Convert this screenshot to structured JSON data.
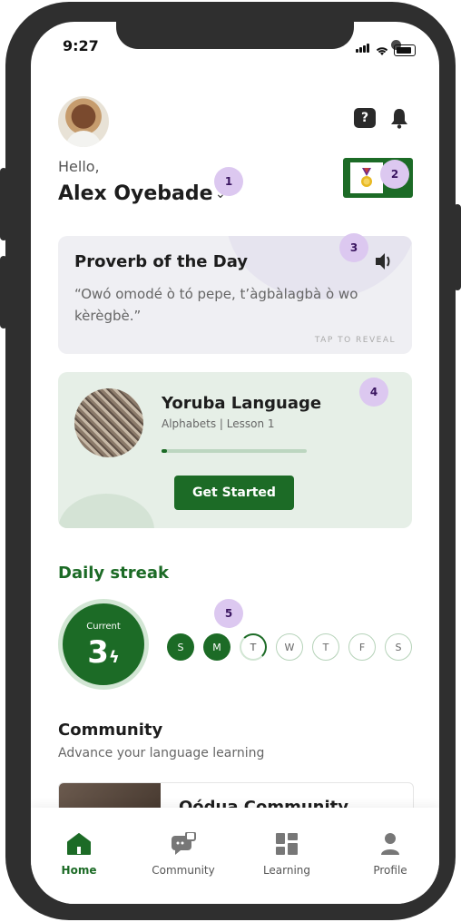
{
  "status_bar": {
    "time": "9:27"
  },
  "header": {
    "greeting": "Hello,",
    "user_name": "Alex Oyebade",
    "chevron": "⌄",
    "help_icon_text": "?"
  },
  "badges": [
    "1",
    "2",
    "3",
    "4",
    "5"
  ],
  "proverb": {
    "title": "Proverb of the Day",
    "text": "“Owó omodé ò tó pepe, t’àgbàlagbà ò wo kèrègbè.”",
    "reveal": "TAP TO REVEAL"
  },
  "lesson": {
    "title": "Yoruba Language",
    "subtitle": "Alphabets | Lesson 1",
    "progress": 0.04,
    "button": "Get Started"
  },
  "streak": {
    "title": "Daily streak",
    "current_label": "Current",
    "current_value": "3",
    "days": [
      {
        "label": "S",
        "state": "done"
      },
      {
        "label": "M",
        "state": "done"
      },
      {
        "label": "T",
        "state": "today"
      },
      {
        "label": "W",
        "state": "todo"
      },
      {
        "label": "T",
        "state": "todo"
      },
      {
        "label": "F",
        "state": "todo"
      },
      {
        "label": "S",
        "state": "todo"
      }
    ]
  },
  "community": {
    "title": "Community",
    "subtitle": "Advance your language learning",
    "card_name": "Oódua Community"
  },
  "tabs": [
    {
      "label": "Home",
      "icon": "home-icon",
      "active": true
    },
    {
      "label": "Community",
      "icon": "chat-icon",
      "active": false
    },
    {
      "label": "Learning",
      "icon": "grid-icon",
      "active": false
    },
    {
      "label": "Profile",
      "icon": "person-icon",
      "active": false
    }
  ],
  "colors": {
    "brand": "#1c6b26",
    "badge": "#dcc8f0"
  }
}
